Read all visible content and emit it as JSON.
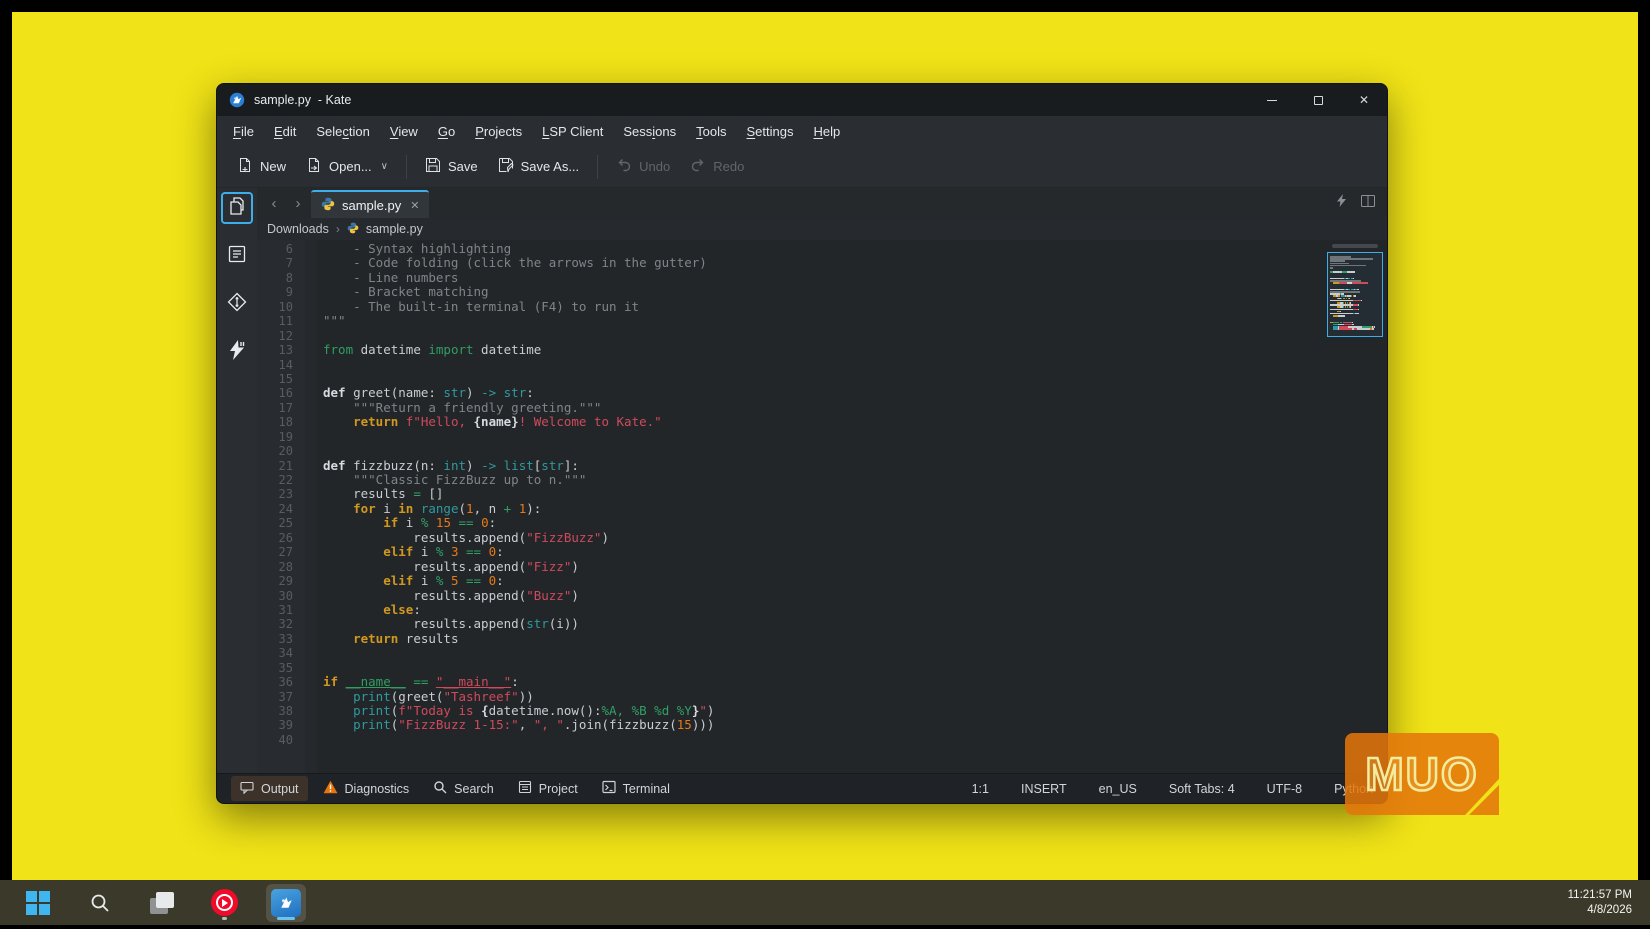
{
  "colors": {
    "wallpaper": "#f0e317",
    "frame": "#000000",
    "taskbar": "#3a392a",
    "accent_blue": "#3daee9",
    "warning_orange": "#e8740c",
    "logo_orange": "#e4760a"
  },
  "window": {
    "title": "sample.py  - Kate",
    "controls": [
      {
        "name": "minimize",
        "icon": "minimize-icon"
      },
      {
        "name": "maximize",
        "icon": "maximize-icon"
      },
      {
        "name": "close",
        "icon": "close-icon"
      }
    ]
  },
  "menu": {
    "items": [
      {
        "label": "File",
        "mnemonic": 0
      },
      {
        "label": "Edit",
        "mnemonic": 0
      },
      {
        "label": "Selection",
        "mnemonic": 4
      },
      {
        "label": "View",
        "mnemonic": 0
      },
      {
        "label": "Go",
        "mnemonic": 0
      },
      {
        "label": "Projects",
        "mnemonic": 0
      },
      {
        "label": "LSP Client",
        "mnemonic": 0
      },
      {
        "label": "Sessions",
        "mnemonic": 4
      },
      {
        "label": "Tools",
        "mnemonic": 0
      },
      {
        "label": "Settings",
        "mnemonic": 0
      },
      {
        "label": "Help",
        "mnemonic": 0
      }
    ]
  },
  "toolbar": {
    "buttons": [
      {
        "label": "New",
        "icon": "new-file-icon",
        "enabled": true
      },
      {
        "label": "Open...",
        "icon": "open-file-icon",
        "enabled": true,
        "chevron": true
      },
      {
        "sep": true
      },
      {
        "label": "Save",
        "icon": "save-icon",
        "enabled": true
      },
      {
        "label": "Save As...",
        "icon": "save-as-icon",
        "enabled": true
      },
      {
        "sep": true
      },
      {
        "label": "Undo",
        "icon": "undo-icon",
        "enabled": false
      },
      {
        "label": "Redo",
        "icon": "redo-icon",
        "enabled": false
      }
    ]
  },
  "sidebar": {
    "items": [
      {
        "name": "documents",
        "icon": "documents-icon",
        "active": true
      },
      {
        "name": "symbols",
        "icon": "symbols-icon",
        "active": false
      },
      {
        "name": "git",
        "icon": "git-icon",
        "active": false
      },
      {
        "name": "lsp",
        "icon": "lsp-bolt-icon",
        "active": false
      }
    ]
  },
  "tabs": {
    "active_label": "sample.py",
    "close_glyph": "✕",
    "nav_back": "‹",
    "nav_forward": "›"
  },
  "breadcrumb": {
    "folder": "Downloads",
    "separator": "›",
    "file": "sample.py"
  },
  "editor": {
    "lines": [
      {
        "n": 6,
        "segs": [
          [
            "    - Syntax highlighting",
            "c"
          ]
        ]
      },
      {
        "n": 7,
        "segs": [
          [
            "    - Code folding (click the arrows in the gutter)",
            "c"
          ]
        ]
      },
      {
        "n": 8,
        "segs": [
          [
            "    - Line numbers",
            "c"
          ]
        ]
      },
      {
        "n": 9,
        "segs": [
          [
            "    - Bracket matching",
            "c"
          ]
        ]
      },
      {
        "n": 10,
        "segs": [
          [
            "    - The built-in terminal (F4) to run it",
            "c"
          ]
        ]
      },
      {
        "n": 11,
        "segs": [
          [
            "\"\"\"",
            "c"
          ]
        ]
      },
      {
        "n": 12,
        "segs": []
      },
      {
        "n": 13,
        "segs": [
          [
            "from",
            "i"
          ],
          [
            " datetime ",
            "d"
          ],
          [
            "import",
            "i"
          ],
          [
            " datetime",
            "d"
          ]
        ]
      },
      {
        "n": 14,
        "segs": []
      },
      {
        "n": 15,
        "segs": []
      },
      {
        "n": 16,
        "segs": [
          [
            "def ",
            "k"
          ],
          [
            "greet(name: ",
            "d"
          ],
          [
            "str",
            "t"
          ],
          [
            ") ",
            "d"
          ],
          [
            "->",
            "t"
          ],
          [
            " ",
            "d"
          ],
          [
            "str",
            "t"
          ],
          [
            ":",
            "d"
          ]
        ]
      },
      {
        "n": 17,
        "segs": [
          [
            "    \"\"\"Return a friendly greeting.\"\"\"",
            "c"
          ]
        ]
      },
      {
        "n": 18,
        "segs": [
          [
            "    ",
            "d"
          ],
          [
            "return ",
            "f"
          ],
          [
            "f\"Hello, ",
            "s"
          ],
          [
            "{name}",
            "b"
          ],
          [
            "! Welcome to Kate.\"",
            "s"
          ]
        ]
      },
      {
        "n": 19,
        "segs": []
      },
      {
        "n": 20,
        "segs": []
      },
      {
        "n": 21,
        "segs": [
          [
            "def ",
            "k"
          ],
          [
            "fizzbuzz(n: ",
            "d"
          ],
          [
            "int",
            "t"
          ],
          [
            ") ",
            "d"
          ],
          [
            "->",
            "t"
          ],
          [
            " ",
            "d"
          ],
          [
            "list",
            "t"
          ],
          [
            "[",
            "d"
          ],
          [
            "str",
            "t"
          ],
          [
            "]:",
            "d"
          ]
        ]
      },
      {
        "n": 22,
        "segs": [
          [
            "    \"\"\"Classic FizzBuzz up to n.\"\"\"",
            "c"
          ]
        ]
      },
      {
        "n": 23,
        "segs": [
          [
            "    results ",
            "d"
          ],
          [
            "=",
            "o"
          ],
          [
            " []",
            "d"
          ]
        ]
      },
      {
        "n": 24,
        "segs": [
          [
            "    ",
            "d"
          ],
          [
            "for",
            "f"
          ],
          [
            " i ",
            "d"
          ],
          [
            "in",
            "f"
          ],
          [
            " ",
            "d"
          ],
          [
            "range",
            "t"
          ],
          [
            "(",
            "d"
          ],
          [
            "1",
            "n"
          ],
          [
            ", n ",
            "d"
          ],
          [
            "+",
            "o"
          ],
          [
            " ",
            "d"
          ],
          [
            "1",
            "n"
          ],
          [
            "):",
            "d"
          ]
        ]
      },
      {
        "n": 25,
        "segs": [
          [
            "        ",
            "d"
          ],
          [
            "if",
            "f"
          ],
          [
            " i ",
            "d"
          ],
          [
            "%",
            "o"
          ],
          [
            " ",
            "d"
          ],
          [
            "15",
            "n"
          ],
          [
            " ",
            "d"
          ],
          [
            "==",
            "o"
          ],
          [
            " ",
            "d"
          ],
          [
            "0",
            "n"
          ],
          [
            ":",
            "d"
          ]
        ]
      },
      {
        "n": 26,
        "segs": [
          [
            "            results.append(",
            "d"
          ],
          [
            "\"FizzBuzz\"",
            "s"
          ],
          [
            ")",
            "d"
          ]
        ]
      },
      {
        "n": 27,
        "segs": [
          [
            "        ",
            "d"
          ],
          [
            "elif",
            "f"
          ],
          [
            " i ",
            "d"
          ],
          [
            "%",
            "o"
          ],
          [
            " ",
            "d"
          ],
          [
            "3",
            "n"
          ],
          [
            " ",
            "d"
          ],
          [
            "==",
            "o"
          ],
          [
            " ",
            "d"
          ],
          [
            "0",
            "n"
          ],
          [
            ":",
            "d"
          ]
        ]
      },
      {
        "n": 28,
        "segs": [
          [
            "            results.append(",
            "d"
          ],
          [
            "\"Fizz\"",
            "s"
          ],
          [
            ")",
            "d"
          ]
        ]
      },
      {
        "n": 29,
        "segs": [
          [
            "        ",
            "d"
          ],
          [
            "elif",
            "f"
          ],
          [
            " i ",
            "d"
          ],
          [
            "%",
            "o"
          ],
          [
            " ",
            "d"
          ],
          [
            "5",
            "n"
          ],
          [
            " ",
            "d"
          ],
          [
            "==",
            "o"
          ],
          [
            " ",
            "d"
          ],
          [
            "0",
            "n"
          ],
          [
            ":",
            "d"
          ]
        ]
      },
      {
        "n": 30,
        "segs": [
          [
            "            results.append(",
            "d"
          ],
          [
            "\"Buzz\"",
            "s"
          ],
          [
            ")",
            "d"
          ]
        ]
      },
      {
        "n": 31,
        "segs": [
          [
            "        ",
            "d"
          ],
          [
            "else",
            "f"
          ],
          [
            ":",
            "d"
          ]
        ]
      },
      {
        "n": 32,
        "segs": [
          [
            "            results.append(",
            "d"
          ],
          [
            "str",
            "t"
          ],
          [
            "(i))",
            "d"
          ]
        ]
      },
      {
        "n": 33,
        "segs": [
          [
            "    ",
            "d"
          ],
          [
            "return",
            "f"
          ],
          [
            " results",
            "d"
          ]
        ]
      },
      {
        "n": 34,
        "segs": []
      },
      {
        "n": 35,
        "segs": []
      },
      {
        "n": 36,
        "segs": [
          [
            "if ",
            "f"
          ],
          [
            "__name__",
            "u"
          ],
          [
            " ",
            "d"
          ],
          [
            "==",
            "o"
          ],
          [
            " ",
            "d"
          ],
          [
            "\"__main__\"",
            "su"
          ],
          [
            ":",
            "d"
          ]
        ]
      },
      {
        "n": 37,
        "segs": [
          [
            "    ",
            "d"
          ],
          [
            "print",
            "t"
          ],
          [
            "(greet(",
            "d"
          ],
          [
            "\"Tashreef\"",
            "s"
          ],
          [
            "))",
            "d"
          ]
        ]
      },
      {
        "n": 38,
        "segs": [
          [
            "    ",
            "d"
          ],
          [
            "print",
            "t"
          ],
          [
            "(",
            "d"
          ],
          [
            "f\"Today is ",
            "s"
          ],
          [
            "{",
            "b"
          ],
          [
            "datetime.now():",
            "d"
          ],
          [
            "%A, %B %d %Y",
            "o"
          ],
          [
            "}",
            "b"
          ],
          [
            "\"",
            "s"
          ],
          [
            ")",
            "d"
          ]
        ]
      },
      {
        "n": 39,
        "segs": [
          [
            "    ",
            "d"
          ],
          [
            "print",
            "t"
          ],
          [
            "(",
            "d"
          ],
          [
            "\"FizzBuzz 1-15:\"",
            "s"
          ],
          [
            ", ",
            "d"
          ],
          [
            "\", \"",
            "s"
          ],
          [
            ".join(fizzbuzz(",
            "d"
          ],
          [
            "15",
            "n"
          ],
          [
            ")))",
            "d"
          ]
        ]
      },
      {
        "n": 40,
        "segs": []
      }
    ]
  },
  "statusbar": {
    "left": [
      {
        "label": "Output",
        "icon": "output-icon",
        "highlight": true
      },
      {
        "label": "Diagnostics",
        "icon": "diagnostics-warning-icon",
        "highlight": false
      },
      {
        "label": "Search",
        "icon": "search-icon",
        "highlight": false
      },
      {
        "label": "Project",
        "icon": "project-icon",
        "highlight": false
      },
      {
        "label": "Terminal",
        "icon": "terminal-icon",
        "highlight": false
      }
    ],
    "right": [
      {
        "name": "cursor-position",
        "label": "1:1"
      },
      {
        "name": "input-mode",
        "label": "INSERT"
      },
      {
        "name": "dictionary",
        "label": "en_US"
      },
      {
        "name": "tab-mode",
        "label": "Soft Tabs: 4"
      },
      {
        "name": "encoding",
        "label": "UTF-8"
      },
      {
        "name": "syntax-mode",
        "label": "Python"
      }
    ]
  },
  "logo": {
    "text": "MUO"
  },
  "taskbar": {
    "icons": [
      {
        "name": "windows-start",
        "icon": "windows-logo-icon",
        "active": false,
        "running": false
      },
      {
        "name": "taskbar-search",
        "icon": "taskbar-search-icon",
        "active": false,
        "running": false
      },
      {
        "name": "task-view",
        "icon": "task-view-icon",
        "active": false,
        "running": false
      },
      {
        "name": "youtube-music",
        "icon": "youtube-music-icon",
        "active": false,
        "running": true
      },
      {
        "name": "kate",
        "icon": "kate-app-icon",
        "active": true,
        "running": true
      }
    ],
    "clock_time": "11:21:57 PM",
    "clock_date": "4/8/2026"
  }
}
